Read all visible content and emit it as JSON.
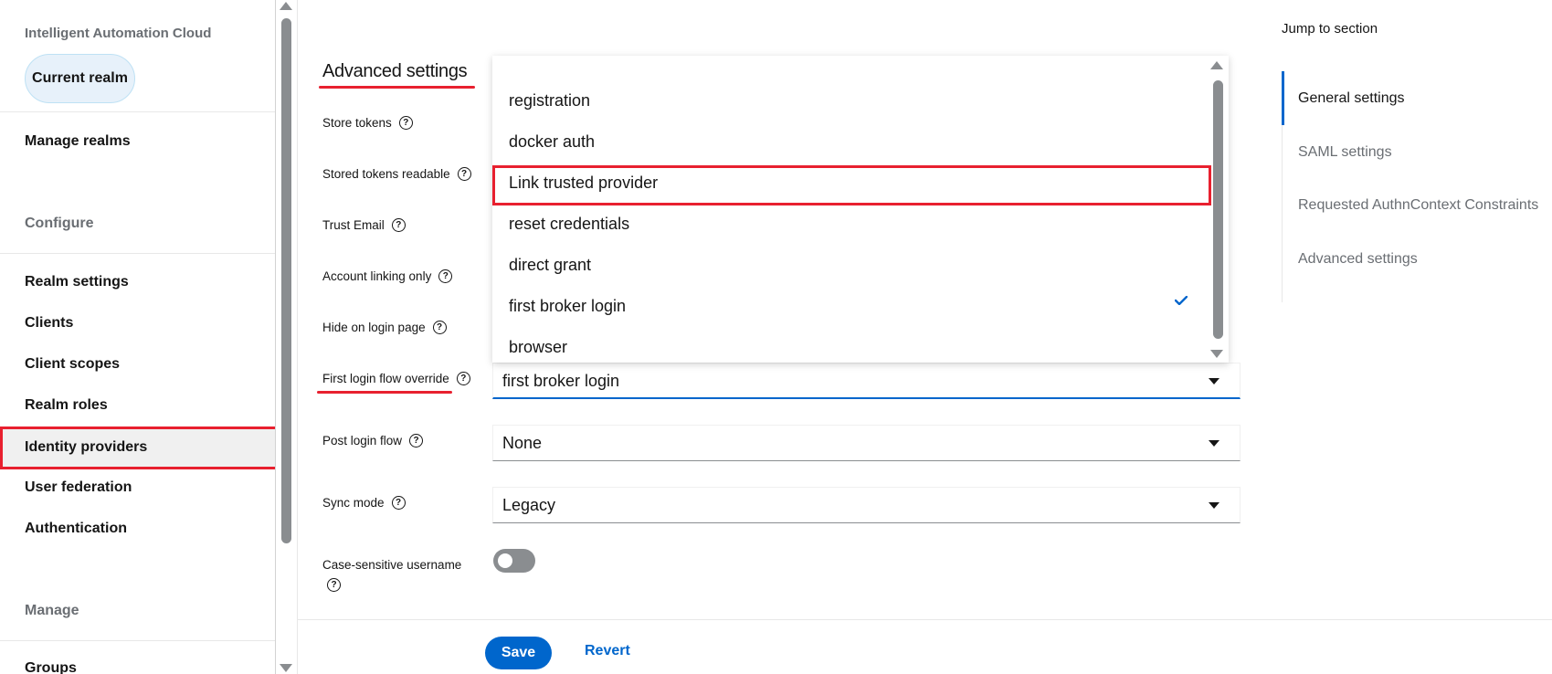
{
  "sidebar": {
    "brand": "Intelligent Automation Cloud",
    "current_realm": "Current realm",
    "manage_realms": "Manage realms",
    "configure_label": "Configure",
    "configure_items": [
      "Realm settings",
      "Clients",
      "Client scopes",
      "Realm roles",
      "Identity providers",
      "User federation",
      "Authentication"
    ],
    "active_item": "Identity providers",
    "manage_label": "Manage",
    "manage_items": [
      "Groups"
    ]
  },
  "advanced": {
    "title": "Advanced settings",
    "labels": {
      "store_tokens": "Store tokens",
      "stored_tokens_readable": "Stored tokens readable",
      "trust_email": "Trust Email",
      "account_linking_only": "Account linking only",
      "hide_on_login_page": "Hide on login page",
      "first_login_flow_override": "First login flow override",
      "post_login_flow": "Post login flow",
      "sync_mode": "Sync mode",
      "case_sensitive_username": "Case-sensitive username"
    },
    "help_icon_glyph": "?",
    "first_login_flow_value": "first broker login",
    "post_login_flow_value": "None",
    "sync_mode_value": "Legacy",
    "case_sensitive_on": false
  },
  "dropdown": {
    "options": [
      "registration",
      "docker auth",
      "Link trusted provider",
      "reset credentials",
      "direct grant",
      "first broker login",
      "browser"
    ],
    "highlighted": "Link trusted provider",
    "selected": "first broker login"
  },
  "footer": {
    "save_label": "Save",
    "revert_label": "Revert"
  },
  "jump": {
    "title": "Jump to section",
    "items": [
      "General settings",
      "SAML settings",
      "Requested AuthnContext Constraints",
      "Advanced settings"
    ],
    "active": "General settings"
  },
  "colors": {
    "primary": "#0066cc",
    "annotation_red": "#e8202f",
    "muted_text": "#6a6e73"
  }
}
